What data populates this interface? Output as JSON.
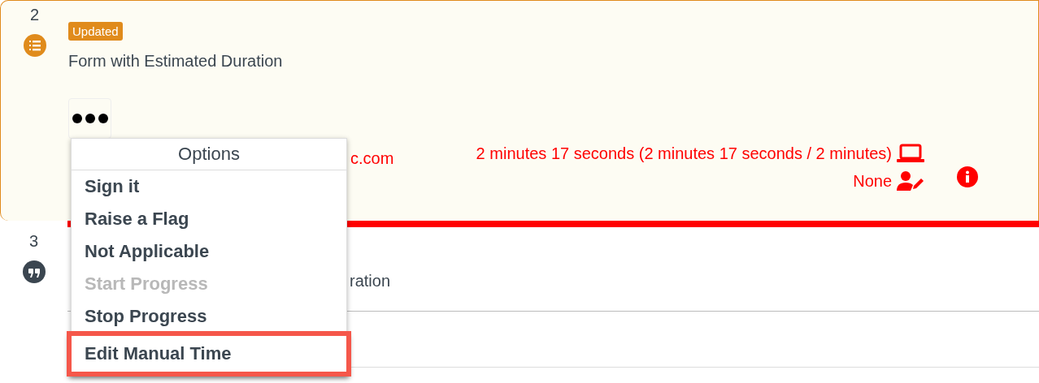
{
  "steps": [
    {
      "number": "2",
      "kind": "list",
      "badge": "Updated",
      "title": "Form with Estimated Duration",
      "email": "c.com",
      "duration": "2 minutes 17 seconds (2 minutes 17 seconds / 2 minutes)",
      "assignee": "None",
      "overdue": true
    },
    {
      "number": "3",
      "kind": "quote",
      "title": "ration"
    }
  ],
  "menu": {
    "title": "Options",
    "items": [
      {
        "label": "Sign it",
        "disabled": false,
        "highlighted": false
      },
      {
        "label": "Raise a Flag",
        "disabled": false,
        "highlighted": false
      },
      {
        "label": "Not Applicable",
        "disabled": false,
        "highlighted": false
      },
      {
        "label": "Start Progress",
        "disabled": true,
        "highlighted": false
      },
      {
        "label": "Stop Progress",
        "disabled": false,
        "highlighted": false
      },
      {
        "label": "Edit Manual Time",
        "disabled": false,
        "highlighted": true
      }
    ]
  }
}
